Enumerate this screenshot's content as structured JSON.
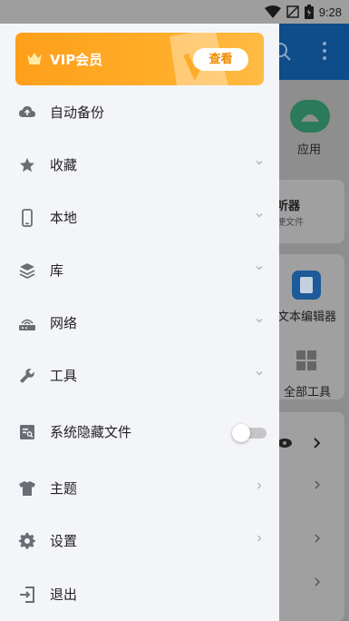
{
  "status_bar": {
    "time": "9:28"
  },
  "background_app": {
    "tab_apps_label": "应用",
    "card_title_partial": "听器",
    "card_sub_partial": "梗文件",
    "text_editor_label": "文本编辑器",
    "all_tools_label": "全部工具"
  },
  "drawer": {
    "vip": {
      "label": "VIP会员",
      "button": "查看"
    },
    "items": [
      {
        "label": "自动备份",
        "icon": "cloud-backup-icon",
        "chevron": "none"
      },
      {
        "label": "收藏",
        "icon": "star-icon",
        "chevron": "down"
      },
      {
        "label": "本地",
        "icon": "phone-icon",
        "chevron": "down"
      },
      {
        "label": "库",
        "icon": "layers-icon",
        "chevron": "down"
      },
      {
        "label": "网络",
        "icon": "network-icon",
        "chevron": "down"
      },
      {
        "label": "工具",
        "icon": "wrench-icon",
        "chevron": "down"
      },
      {
        "label": "系统隐藏文件",
        "icon": "hidden-files-icon",
        "chevron": "toggle",
        "enabled": false
      },
      {
        "label": "主题",
        "icon": "shirt-icon",
        "chevron": "right"
      },
      {
        "label": "设置",
        "icon": "gear-icon",
        "chevron": "right"
      },
      {
        "label": "退出",
        "icon": "exit-icon",
        "chevron": "none"
      }
    ]
  },
  "colors": {
    "accent_orange": "#ffa01c",
    "vip_button_text": "#f08a00",
    "drawer_bg": "#f4f5f9",
    "icon_gray": "#6a6d73"
  }
}
